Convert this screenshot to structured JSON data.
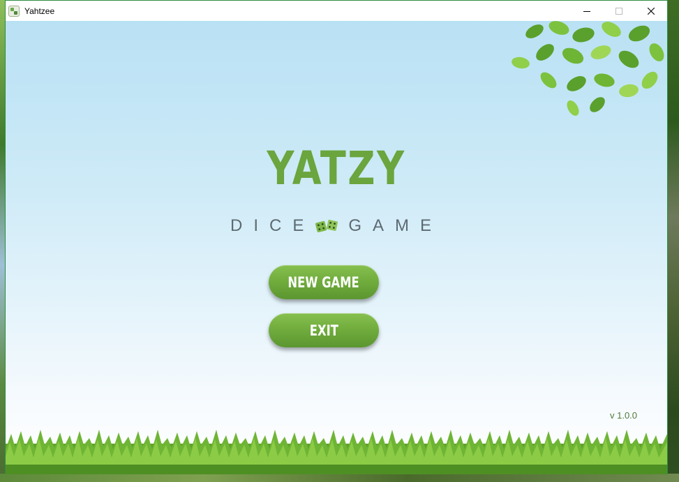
{
  "window": {
    "title": "Yahtzee"
  },
  "caption": {
    "minimize": "minimize-icon",
    "maximize": "maximize-icon",
    "close": "close-icon"
  },
  "game": {
    "title": "YATZY",
    "subtitle_left": "DICE",
    "subtitle_right": "GAME",
    "new_game_label": "NEW GAME",
    "exit_label": "EXIT",
    "version": "v 1.0.0"
  },
  "colors": {
    "accent_green": "#6aa53e",
    "sky_blue": "#b9e1f4",
    "text_gray": "#5d6b73"
  }
}
